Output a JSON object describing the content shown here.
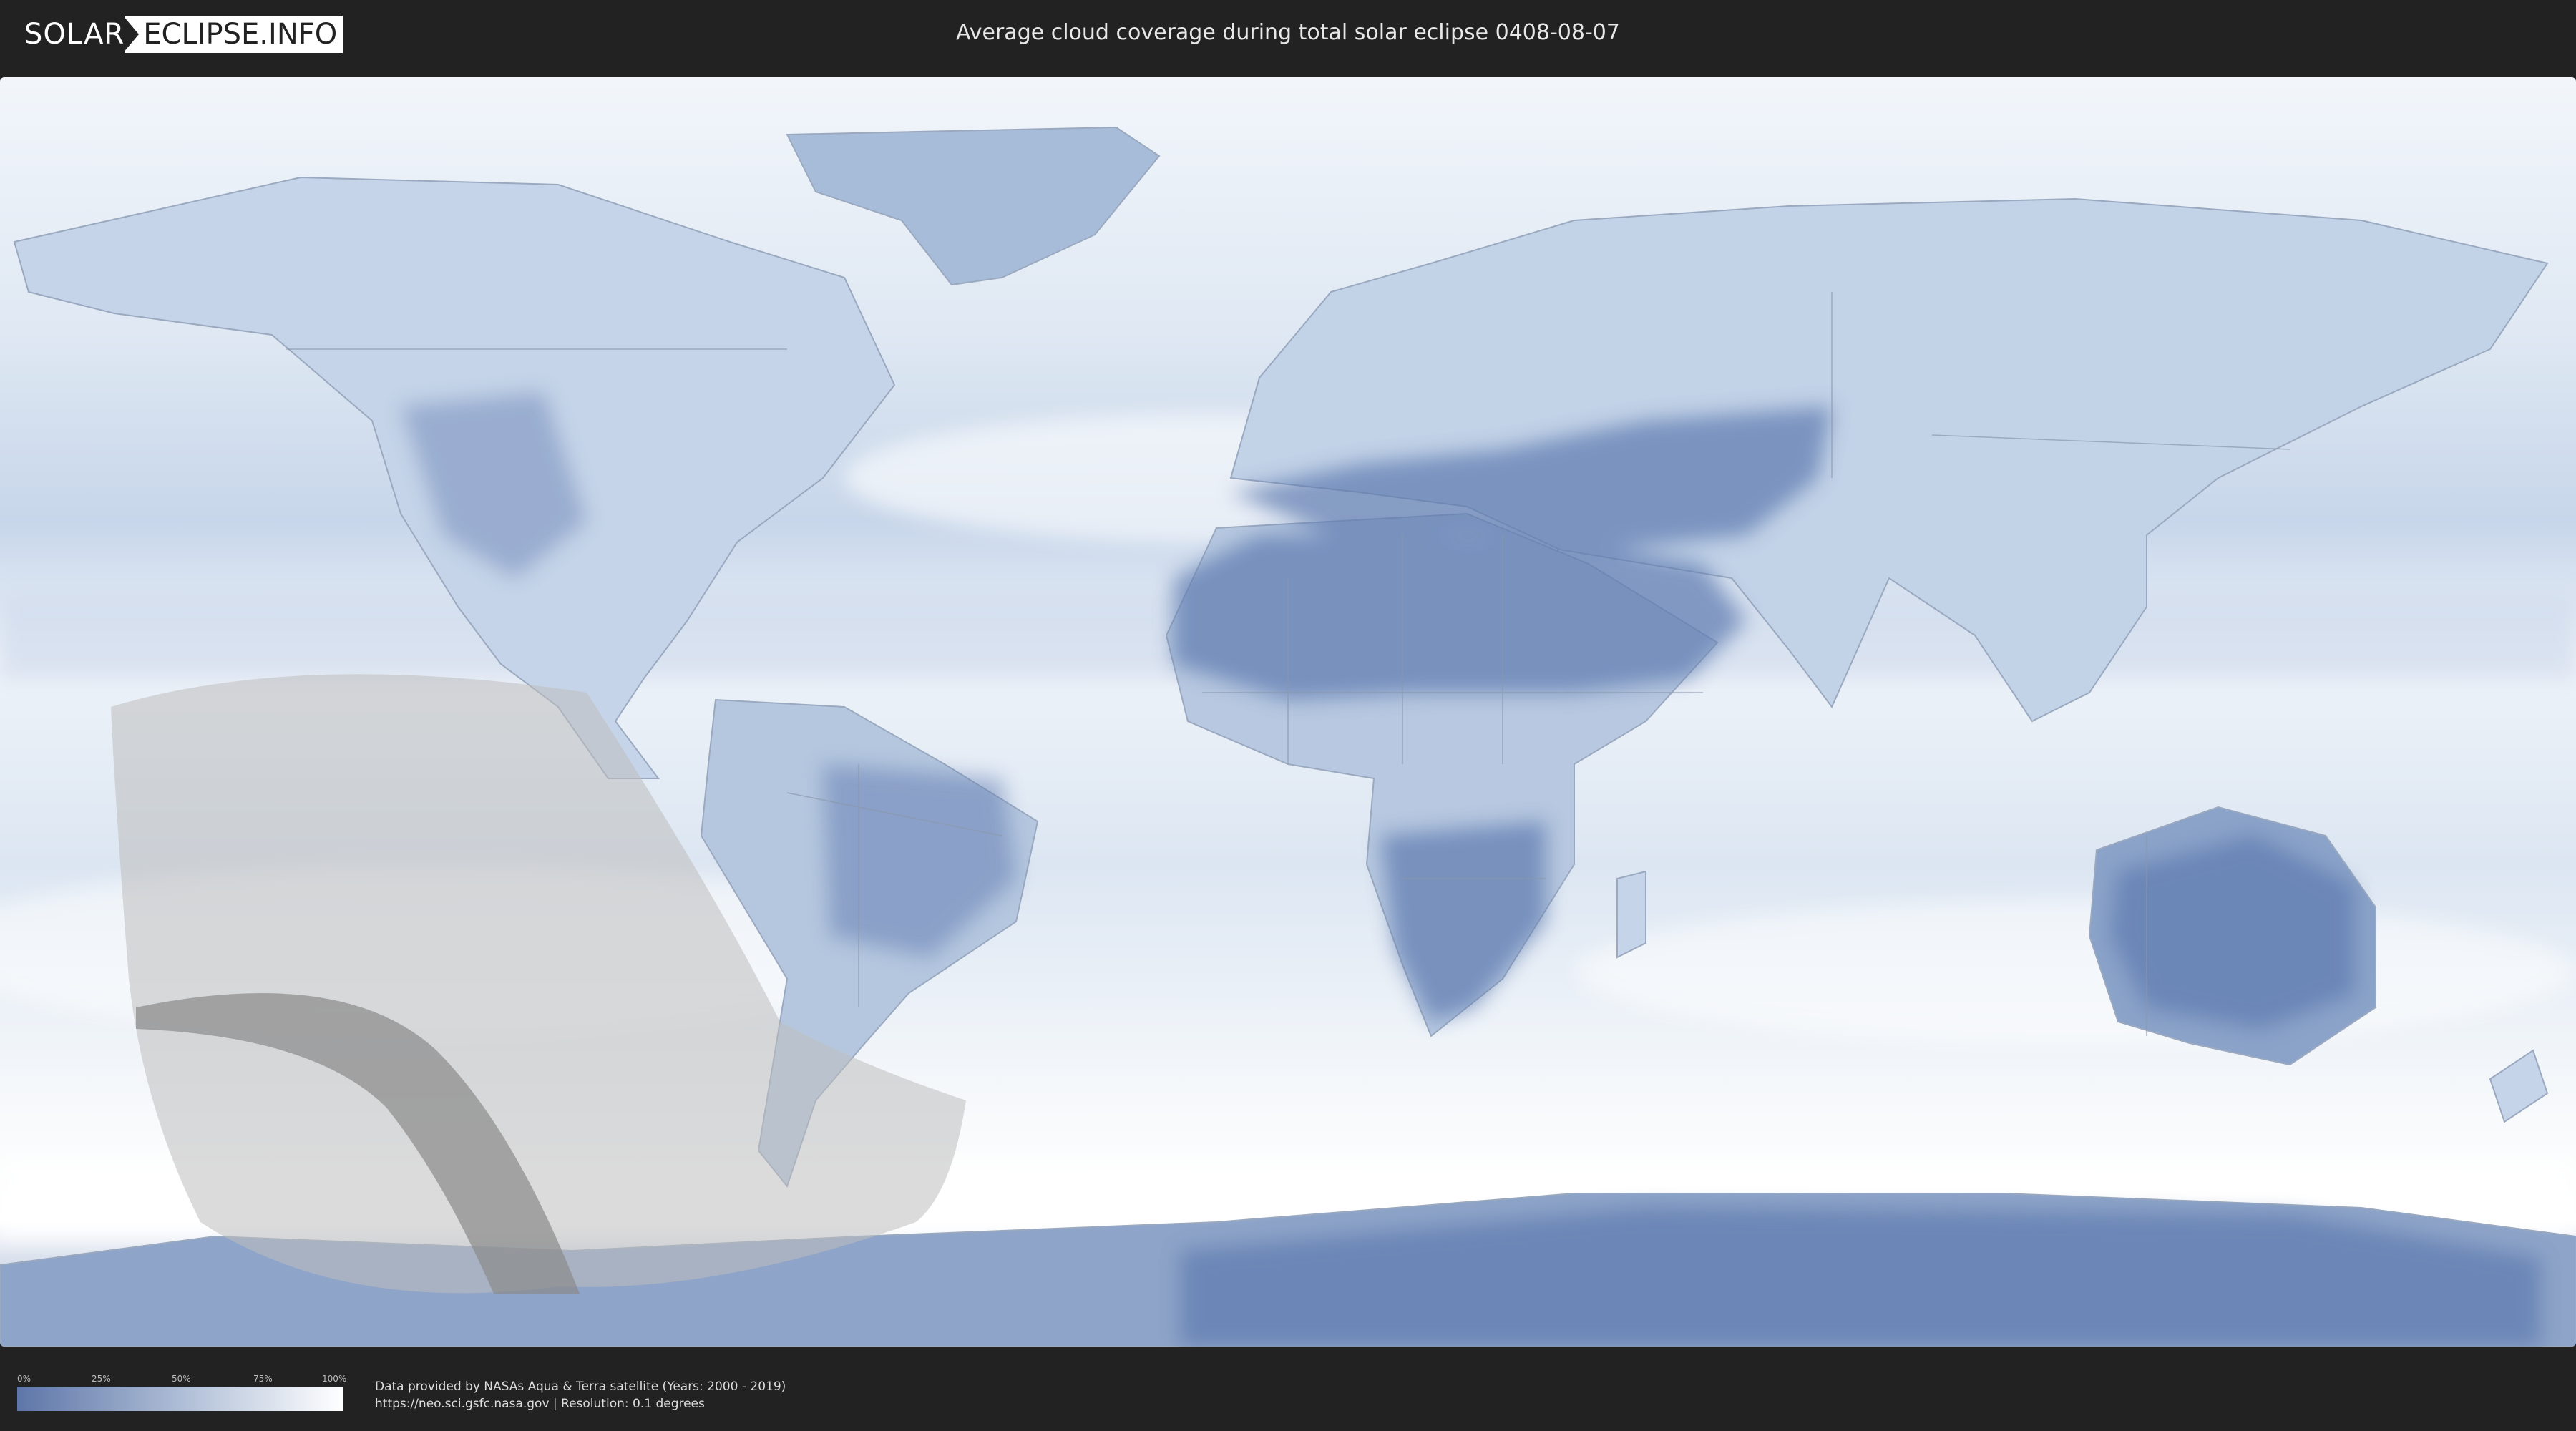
{
  "header": {
    "logo_left": "SOLAR",
    "logo_right": "ECLIPSE.INFO",
    "title": "Average cloud coverage during total solar eclipse 0408-08-07"
  },
  "legend": {
    "ticks": [
      "0%",
      "25%",
      "50%",
      "75%",
      "100%"
    ],
    "gradient_colors": [
      "#5e76a8",
      "#aebdd6",
      "#ffffff"
    ]
  },
  "credits": {
    "line1": "Data provided by NASAs Aqua & Terra satellite (Years: 2000 - 2019)",
    "line2": "https://neo.sci.gsfc.nasa.gov | Resolution: 0.1 degrees"
  },
  "map": {
    "ocean_color": "#dfe8f3",
    "clear_color": "#6f88b8",
    "cloud_color": "#ffffff",
    "eclipse_visibility_color": "#bdbdbd",
    "eclipse_path_color": "#8a8a8a"
  }
}
